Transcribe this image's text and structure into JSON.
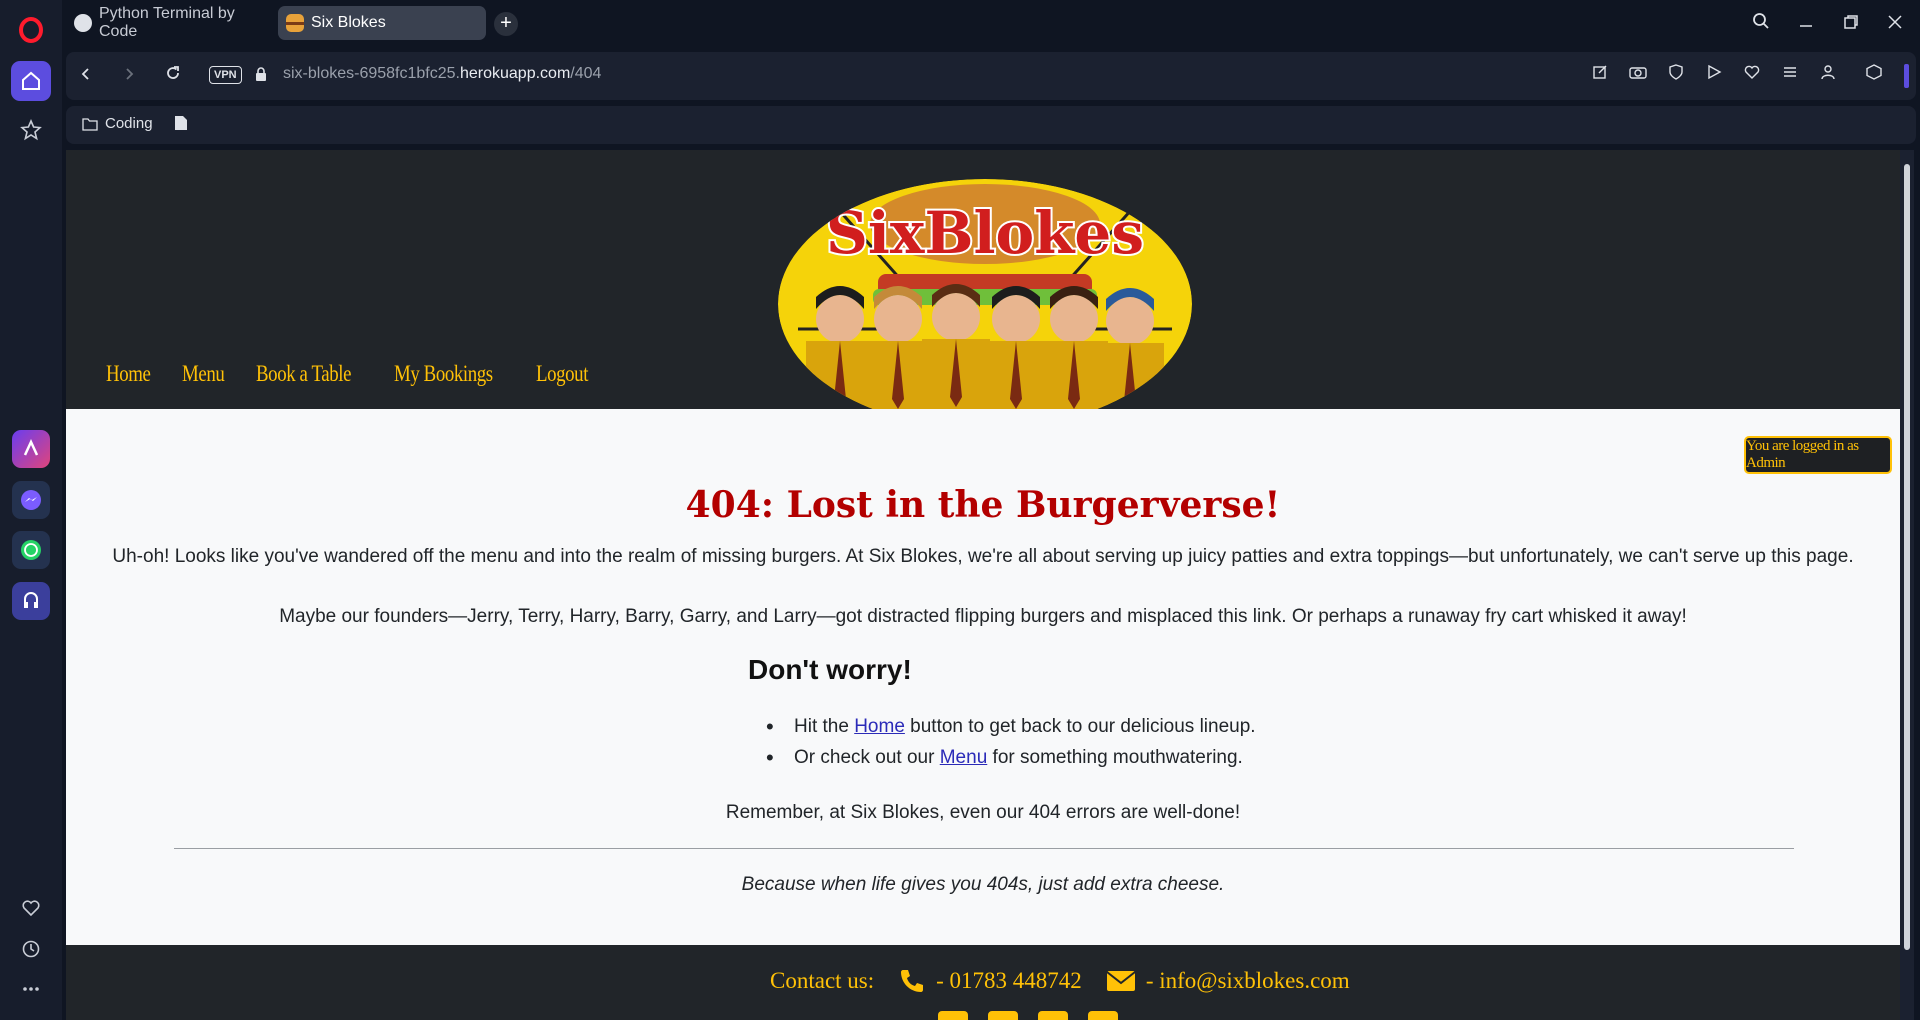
{
  "browser": {
    "tabs": [
      {
        "label": "Python Terminal by Code",
        "active": false
      },
      {
        "label": "Six Blokes",
        "active": true
      }
    ],
    "new_tab_label": "+",
    "vpn_label": "VPN",
    "url": {
      "prefix": "six-blokes-6958fc1bfc25.",
      "domain": "herokuapp.com",
      "path": "/404"
    },
    "bookmarks": [
      {
        "label": "Coding"
      }
    ]
  },
  "site": {
    "logo_text": "SixBlokes",
    "nav": [
      {
        "label": "Home"
      },
      {
        "label": "Menu"
      },
      {
        "label": "Book a Table"
      },
      {
        "label": "My Bookings"
      },
      {
        "label": "Logout"
      }
    ],
    "login_status": "You are logged in as Admin"
  },
  "content": {
    "title": "404: Lost in the Burgerverse!",
    "p1": "Uh-oh! Looks like you've wandered off the menu and into the realm of missing burgers. At Six Blokes, we're all about serving up juicy patties and extra toppings—but unfortunately, we can't serve up this page.",
    "p2": "Maybe our founders—Jerry, Terry, Harry, Barry, Garry, and Larry—got distracted flipping burgers and misplaced this link. Or perhaps a runaway fry cart whisked it away!",
    "worry_heading": "Don't worry!",
    "list": [
      {
        "before": "Hit the ",
        "link": "Home",
        "after": " button to get back to our delicious lineup."
      },
      {
        "before": "Or check out our ",
        "link": "Menu",
        "after": " for something mouthwatering."
      }
    ],
    "p3": "Remember, at Six Blokes, even our 404 errors are well-done!",
    "tagline": "Because when life gives you 404s, just add extra cheese."
  },
  "footer": {
    "contact_label": "Contact us:",
    "phone": "- 01783 448742",
    "email": "- info@sixblokes.com"
  },
  "colors": {
    "accent": "#ffc107",
    "error_title": "#b30000",
    "header_bg": "#212529",
    "page_bg": "#f8f9fa"
  }
}
